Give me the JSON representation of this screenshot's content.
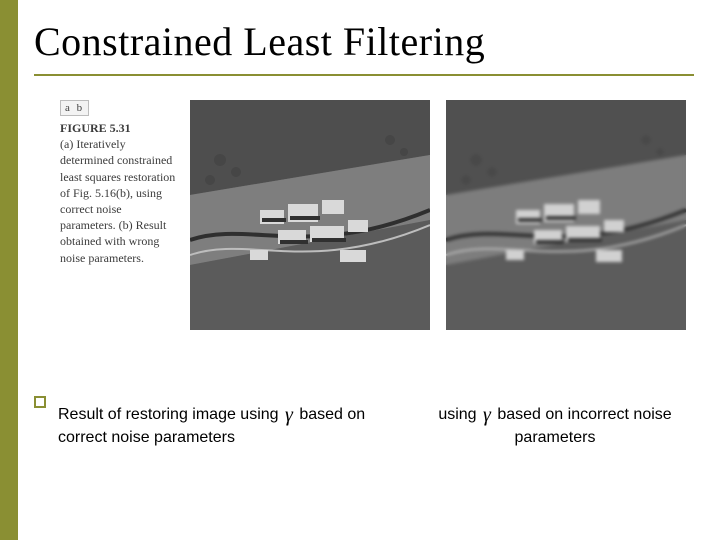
{
  "slide": {
    "title": "Constrained Least Filtering"
  },
  "figure": {
    "ab_label": "a b",
    "number_label": "FIGURE 5.31",
    "caption_a": "(a) Iteratively determined constrained least squares restoration of Fig. 5.16(b), using correct noise parameters.",
    "caption_b": "(b) Result obtained with wrong noise parameters."
  },
  "captions": {
    "left_pre": "Result of restoring image using ",
    "left_post": " based on correct noise parameters",
    "right_pre": "using ",
    "right_post": " based on incorrect noise parameters",
    "gamma": "γ"
  },
  "theme": {
    "accent": "#8a8f33"
  }
}
